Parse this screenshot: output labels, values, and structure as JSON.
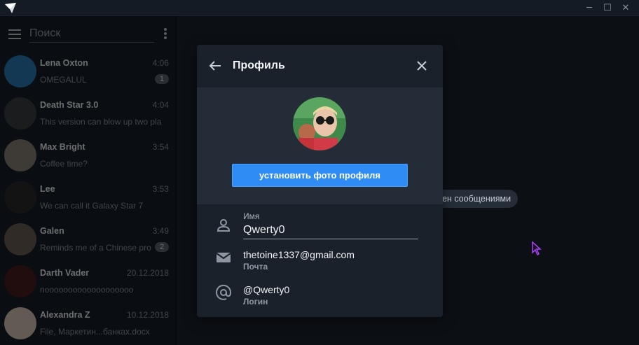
{
  "window": {
    "logo_icon": "paper-plane-logo",
    "controls": {
      "minimize": "─",
      "maximize": "☐",
      "close": "✕"
    }
  },
  "sidebar": {
    "search_placeholder": "Поиск",
    "chats": [
      {
        "name": "Lena Oxton",
        "time": "4:06",
        "message": "OMEGALUL",
        "badge": "1",
        "avatar_color": "#2a7db8"
      },
      {
        "name": "Death Star 3.0",
        "time": "4:04",
        "message": "This version can blow up two pla",
        "badge": "",
        "avatar_color": "#3b3f44"
      },
      {
        "name": "Max Bright",
        "time": "3:54",
        "message": "Coffee time?",
        "badge": "",
        "avatar_color": "#8a8276"
      },
      {
        "name": "Lee",
        "time": "3:53",
        "message": "We can call it Galaxy Star 7",
        "badge": "",
        "avatar_color": "#2b2a2c"
      },
      {
        "name": "Galen",
        "time": "3:49",
        "message": "Reminds me of a Chinese pro",
        "badge": "2",
        "avatar_color": "#6b6156"
      },
      {
        "name": "Darth Vader",
        "time": "20.12.2018",
        "message": "nooooooooooooooooooo",
        "badge": "",
        "avatar_color": "#4a1c1f"
      },
      {
        "name": "Alexandra Z",
        "time": "10.12.2018",
        "message": "File, Маркетин...банках.docx",
        "badge": "",
        "avatar_color": "#d9c8b8"
      }
    ]
  },
  "main": {
    "service_message": "ен сообщениями"
  },
  "dialog": {
    "title": "Профиль",
    "set_photo_label": "установить фото профиля",
    "name_label": "Имя",
    "name_value": "Qwerty0",
    "email_value": "thetoine1337@gmail.com",
    "email_label": "Почта",
    "login_value": "@Qwerty0",
    "login_label": "Логин"
  },
  "colors": {
    "accent": "#2f8cf4",
    "cursor": "#b040ff"
  }
}
